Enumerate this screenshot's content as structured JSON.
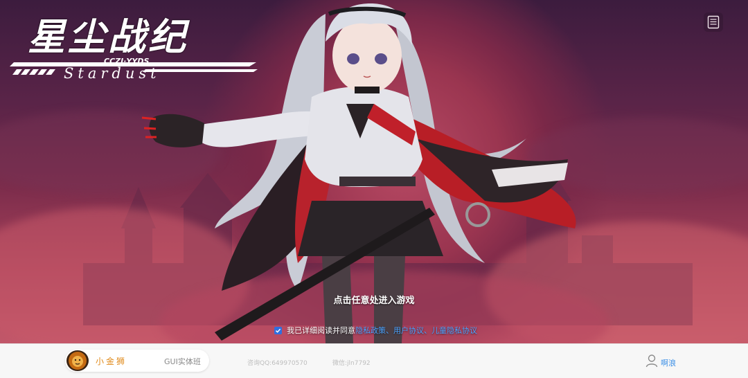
{
  "logo": {
    "title": "星尘战纪",
    "subtitle": "CCZJ·YYDS",
    "english": "Stardust"
  },
  "main": {
    "enter_hint": "点击任意处进入游戏",
    "agreement": {
      "checked": true,
      "prefix": "我已详细阅读并同意",
      "links": [
        "隐私政策",
        "用户协议",
        "儿童隐私协议"
      ],
      "sep1": "、",
      "sep2": "、"
    }
  },
  "icons": {
    "menu": "notice-list-icon",
    "user": "user-icon",
    "brand": "lion-logo-icon"
  },
  "footer": {
    "brand_name": "小金狮",
    "course": "GUI实体班",
    "qq": "咨询QQ:649970570",
    "wechat": "微信:jln7792",
    "username": "啊浪"
  },
  "colors": {
    "link": "#4aa3ff",
    "brand": "#e08a1a",
    "username": "#3b8fe6",
    "checkbox": "#2f6fe0"
  }
}
